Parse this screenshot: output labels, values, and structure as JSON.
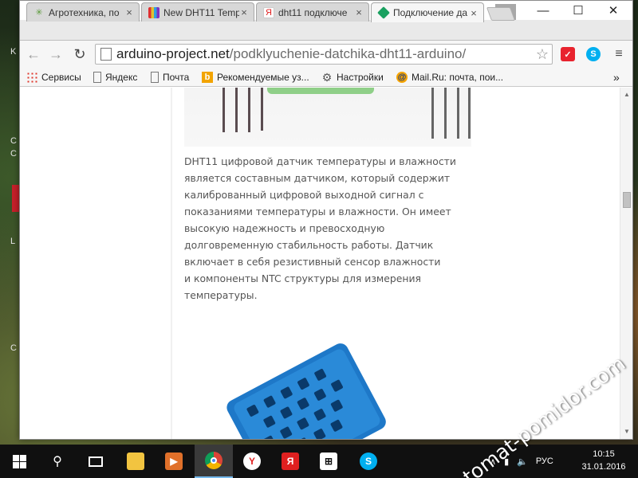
{
  "browser": {
    "tabs": [
      {
        "label": "Агротехника, по",
        "favicon": "leaf-icon",
        "color": "#5a9a3a"
      },
      {
        "label": "New DHT11 Temp",
        "favicon": "colorbars-icon",
        "color": "#c04040"
      },
      {
        "label": "dht11 подключе",
        "favicon": "yandex-icon",
        "color": "#e02020"
      },
      {
        "label": "Подключение да",
        "favicon": "green-cube-icon",
        "color": "#1aa060"
      }
    ],
    "window_controls": {
      "minimize": "—",
      "maximize": "☐",
      "close": "✕"
    },
    "url": {
      "domain": "arduino-project.net",
      "path": "/podklyuchenie-datchika-dht11-arduino/"
    },
    "extensions": [
      {
        "name": "antivirus-extension-icon",
        "color": "#e8232e"
      },
      {
        "name": "skype-extension-icon",
        "color": "#00aff0"
      }
    ],
    "bookmarks": [
      {
        "label": "Сервисы",
        "icon": "apps-grid-icon"
      },
      {
        "label": "Яндекс",
        "icon": "page-icon"
      },
      {
        "label": "Почта",
        "icon": "page-icon"
      },
      {
        "label": "Рекомендуемые уз...",
        "icon": "bing-icon"
      },
      {
        "label": "Настройки",
        "icon": "gear-icon"
      },
      {
        "label": "Mail.Ru: почта, пои...",
        "icon": "mailru-icon"
      }
    ],
    "bookmarks_overflow": "»"
  },
  "article": {
    "lines": [
      "DHT11 цифровой датчик температуры и влажности",
      "является составным датчиком, который содержит",
      "калиброванный цифровой выходной сигнал с",
      "показаниями температуры и влажности. Он имеет",
      "высокую надежность и превосходную",
      "долговременную стабильность работы. Датчик",
      "включает в себя резистивный сенсор влажности",
      "и компоненты NTC структуры для измерения",
      "температуры."
    ]
  },
  "watermark": "tomat-pomidor.com",
  "taskbar": {
    "language": "РУС",
    "time": "10:15",
    "date": "31.01.2016"
  }
}
